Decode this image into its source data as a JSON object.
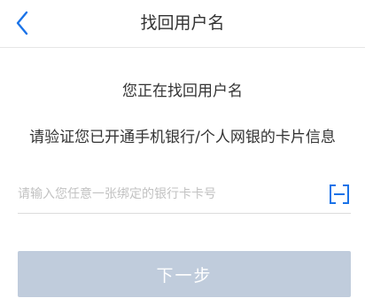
{
  "header": {
    "title": "找回用户名",
    "back_icon": "chevron-left-icon"
  },
  "main": {
    "subtitle": "您正在找回用户名",
    "instruction": "请验证您已开通手机银行/个人网银的卡片信息",
    "card_input": {
      "value": "",
      "placeholder": "请输入您任意一张绑定的银行卡卡号"
    },
    "scan_icon": "card-scan-icon",
    "next_label": "下一步"
  },
  "colors": {
    "accent": "#1a73e8",
    "button_disabled_bg": "#c0ccdc",
    "divider": "#e6e6e6",
    "placeholder": "#c2c2c2"
  }
}
